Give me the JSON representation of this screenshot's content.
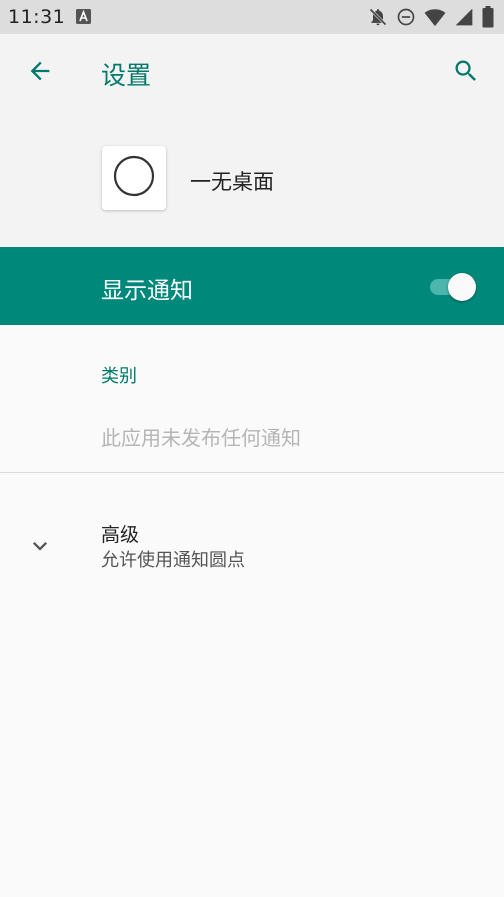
{
  "status_bar": {
    "time": "11:31",
    "icons": [
      "a-notification-icon",
      "bell-off-icon",
      "do-not-disturb-icon",
      "wifi-icon",
      "signal-icon",
      "battery-icon"
    ]
  },
  "app_bar": {
    "title": "设置"
  },
  "app_header": {
    "app_name": "一无桌面"
  },
  "notifications": {
    "label": "显示通知",
    "enabled": true
  },
  "category": {
    "header": "类别",
    "empty_message": "此应用未发布任何通知"
  },
  "advanced": {
    "title": "高级",
    "summary": "允许使用通知圆点"
  },
  "colors": {
    "accent": "#00796b",
    "bar": "#00897b",
    "switch_track": "#4db6ac"
  }
}
